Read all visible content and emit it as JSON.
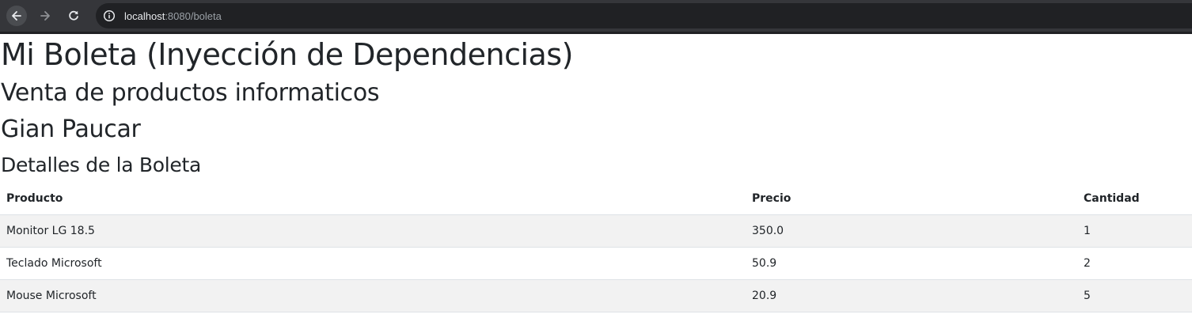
{
  "browser": {
    "url_host": "localhost",
    "url_rest": ":8080/boleta",
    "colors": {
      "toolbar": "#35363a",
      "omnibox": "#202124"
    }
  },
  "page": {
    "title": "Mi Boleta (Inyección de Dependencias)",
    "subtitle": "Venta de productos informaticos",
    "customer": "Gian Paucar",
    "details_heading": "Detalles de la Boleta"
  },
  "table": {
    "headers": [
      "Producto",
      "Precio",
      "Cantidad"
    ],
    "rows": [
      [
        "Monitor LG 18.5",
        "350.0",
        "1"
      ],
      [
        "Teclado Microsoft",
        "50.9",
        "2"
      ],
      [
        "Mouse Microsoft",
        "20.9",
        "5"
      ]
    ]
  },
  "icons": {
    "back": "arrow-left-icon",
    "forward": "arrow-right-icon",
    "reload": "reload-icon",
    "site_info": "info-icon"
  }
}
